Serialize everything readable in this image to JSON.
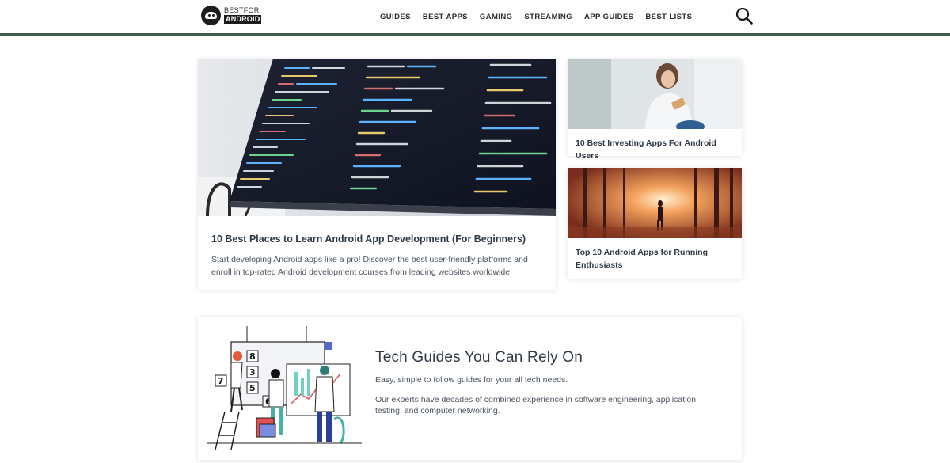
{
  "brand": {
    "top": "BESTFOR",
    "bottom": "ANDROID"
  },
  "nav": [
    {
      "label": "GUIDES"
    },
    {
      "label": "BEST APPS"
    },
    {
      "label": "GAMING"
    },
    {
      "label": "STREAMING"
    },
    {
      "label": "APP GUIDES"
    },
    {
      "label": "BEST LISTS"
    }
  ],
  "colors": {
    "header_rule": "#3f5b4c",
    "text": "#2f3a45"
  },
  "featured": {
    "title": "10 Best Places to Learn Android App Development (For Beginners)",
    "description": "Start developing Android apps like a pro! Discover the best user-friendly platforms and enroll in top-rated Android development courses from leading websites worldwide."
  },
  "side_articles": [
    {
      "title": "10 Best Investing Apps For Android Users"
    },
    {
      "title": "Top 10 Android Apps for Running Enthusiasts"
    }
  ],
  "guides": {
    "title": "Tech Guides You Can Rely On",
    "subtitle": "Easy, simple to follow guides for your all tech needs.",
    "body": "Our experts have decades of combined experience in software engineering, application testing, and computer networking."
  }
}
